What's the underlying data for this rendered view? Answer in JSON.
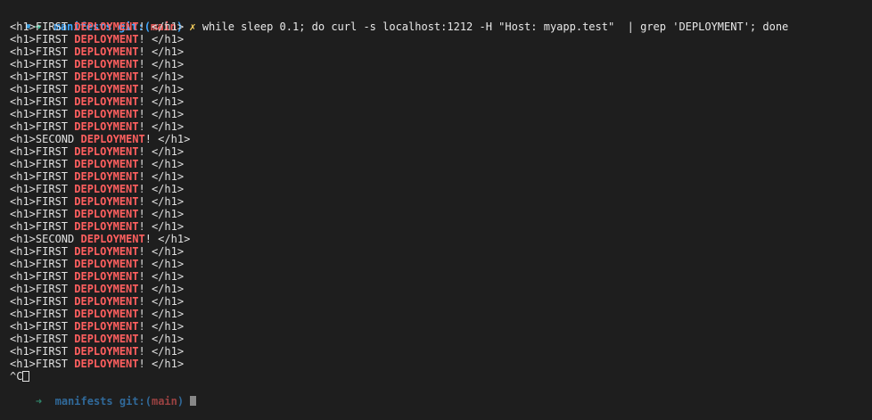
{
  "prompt": {
    "arrow": "➜",
    "dir": "manifests",
    "git_label": "git:(",
    "branch": "main",
    "git_close": ")",
    "dirty_mark": "✗",
    "command": "while sleep 0.1; do curl -s localhost:1212 -H \"Host: myapp.test\"  | grep 'DEPLOYMENT'; done"
  },
  "output_lines": [
    {
      "before": "<h1>FIRST ",
      "match": "DEPLOYMENT",
      "after": "! </h1>"
    },
    {
      "before": "<h1>FIRST ",
      "match": "DEPLOYMENT",
      "after": "! </h1>"
    },
    {
      "before": "<h1>FIRST ",
      "match": "DEPLOYMENT",
      "after": "! </h1>"
    },
    {
      "before": "<h1>FIRST ",
      "match": "DEPLOYMENT",
      "after": "! </h1>"
    },
    {
      "before": "<h1>FIRST ",
      "match": "DEPLOYMENT",
      "after": "! </h1>"
    },
    {
      "before": "<h1>FIRST ",
      "match": "DEPLOYMENT",
      "after": "! </h1>"
    },
    {
      "before": "<h1>FIRST ",
      "match": "DEPLOYMENT",
      "after": "! </h1>"
    },
    {
      "before": "<h1>FIRST ",
      "match": "DEPLOYMENT",
      "after": "! </h1>"
    },
    {
      "before": "<h1>FIRST ",
      "match": "DEPLOYMENT",
      "after": "! </h1>"
    },
    {
      "before": "<h1>SECOND ",
      "match": "DEPLOYMENT",
      "after": "! </h1>"
    },
    {
      "before": "<h1>FIRST ",
      "match": "DEPLOYMENT",
      "after": "! </h1>"
    },
    {
      "before": "<h1>FIRST ",
      "match": "DEPLOYMENT",
      "after": "! </h1>"
    },
    {
      "before": "<h1>FIRST ",
      "match": "DEPLOYMENT",
      "after": "! </h1>"
    },
    {
      "before": "<h1>FIRST ",
      "match": "DEPLOYMENT",
      "after": "! </h1>"
    },
    {
      "before": "<h1>FIRST ",
      "match": "DEPLOYMENT",
      "after": "! </h1>"
    },
    {
      "before": "<h1>FIRST ",
      "match": "DEPLOYMENT",
      "after": "! </h1>"
    },
    {
      "before": "<h1>FIRST ",
      "match": "DEPLOYMENT",
      "after": "! </h1>"
    },
    {
      "before": "<h1>SECOND ",
      "match": "DEPLOYMENT",
      "after": "! </h1>"
    },
    {
      "before": "<h1>FIRST ",
      "match": "DEPLOYMENT",
      "after": "! </h1>"
    },
    {
      "before": "<h1>FIRST ",
      "match": "DEPLOYMENT",
      "after": "! </h1>"
    },
    {
      "before": "<h1>FIRST ",
      "match": "DEPLOYMENT",
      "after": "! </h1>"
    },
    {
      "before": "<h1>FIRST ",
      "match": "DEPLOYMENT",
      "after": "! </h1>"
    },
    {
      "before": "<h1>FIRST ",
      "match": "DEPLOYMENT",
      "after": "! </h1>"
    },
    {
      "before": "<h1>FIRST ",
      "match": "DEPLOYMENT",
      "after": "! </h1>"
    },
    {
      "before": "<h1>FIRST ",
      "match": "DEPLOYMENT",
      "after": "! </h1>"
    },
    {
      "before": "<h1>FIRST ",
      "match": "DEPLOYMENT",
      "after": "! </h1>"
    },
    {
      "before": "<h1>FIRST ",
      "match": "DEPLOYMENT",
      "after": "! </h1>"
    },
    {
      "before": "<h1>FIRST ",
      "match": "DEPLOYMENT",
      "after": "! </h1>"
    }
  ],
  "interrupt": "^C",
  "next_prompt": {
    "arrow": "➜",
    "dir": "manifests",
    "git_label": "git:(",
    "branch": "main",
    "git_close": ")"
  },
  "colors": {
    "background": "#1e1e1e",
    "match": "#ff5f5f",
    "dir": "#3fa7ff",
    "arrow": "#3fd9a8",
    "dirty": "#ffd75f"
  }
}
